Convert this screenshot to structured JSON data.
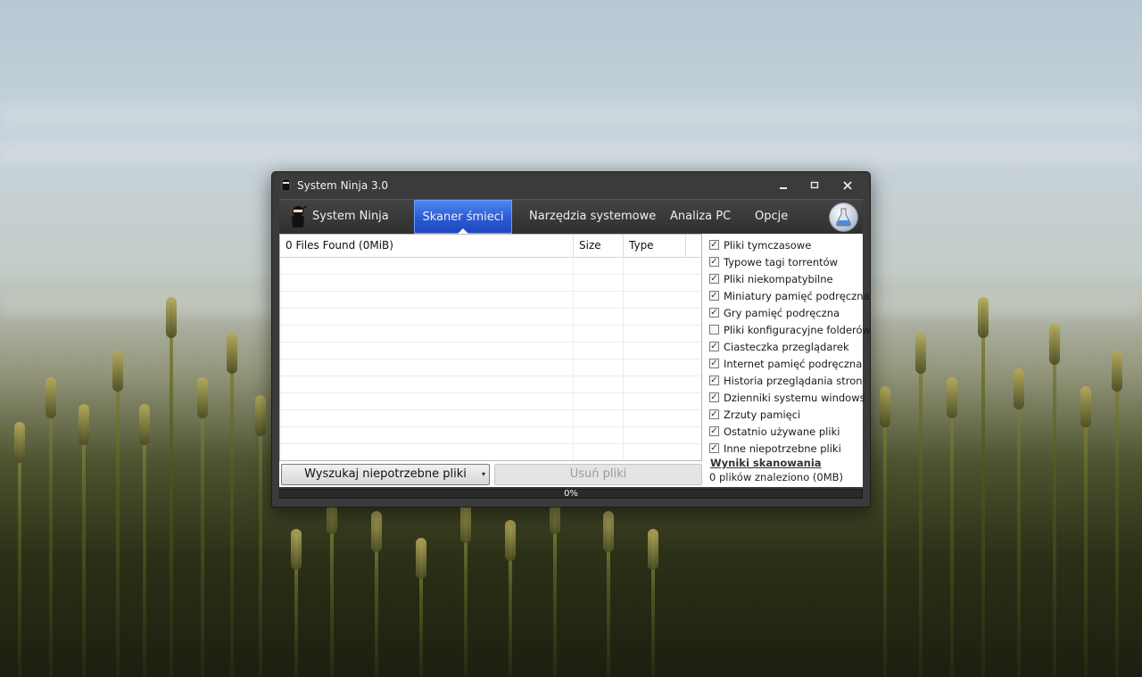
{
  "window": {
    "title": "System Ninja 3.0",
    "minimize_icon": "minimize-icon",
    "maximize_icon": "maximize-icon",
    "close_icon": "close-icon"
  },
  "nav": {
    "items": [
      {
        "label": "System Ninja",
        "icon": "ninja-icon",
        "active": false
      },
      {
        "label": "Skaner śmieci",
        "active": true
      },
      {
        "label": "Narzędzia systemowe",
        "active": false
      },
      {
        "label": "Analiza PC",
        "active": false
      },
      {
        "label": "Opcje",
        "active": false
      }
    ],
    "right_icon": "lab-flask-icon",
    "active_color": "#2f62dc"
  },
  "filelist": {
    "columns": [
      "0 Files Found (0MiB)",
      "Size",
      "Type"
    ],
    "rows": []
  },
  "buttons": {
    "scan": "Wyszukaj niepotrzebne pliki",
    "delete": "Usuń pliki"
  },
  "options": [
    {
      "label": "Pliki tymczasowe",
      "checked": true
    },
    {
      "label": "Typowe tagi torrentów",
      "checked": true
    },
    {
      "label": "Pliki niekompatybilne",
      "checked": true
    },
    {
      "label": "Miniatury pamięć podręczna",
      "checked": true
    },
    {
      "label": "Gry pamięć podręczna",
      "checked": true
    },
    {
      "label": "Pliki konfiguracyjne folderów",
      "checked": false
    },
    {
      "label": "Ciasteczka przeglądarek",
      "checked": true
    },
    {
      "label": "Internet pamięć podręczna",
      "checked": true
    },
    {
      "label": "Historia przeglądania stron",
      "checked": true
    },
    {
      "label": "Dzienniki systemu windows",
      "checked": true
    },
    {
      "label": "Zrzuty pamięci",
      "checked": true
    },
    {
      "label": "Ostatnio używane pliki",
      "checked": true
    },
    {
      "label": "Inne niepotrzebne pliki",
      "checked": true
    }
  ],
  "results": {
    "title": "Wyniki skanowania",
    "text": "0 plików znaleziono (0MB)"
  },
  "progress": {
    "value": 0,
    "label": "0%"
  }
}
